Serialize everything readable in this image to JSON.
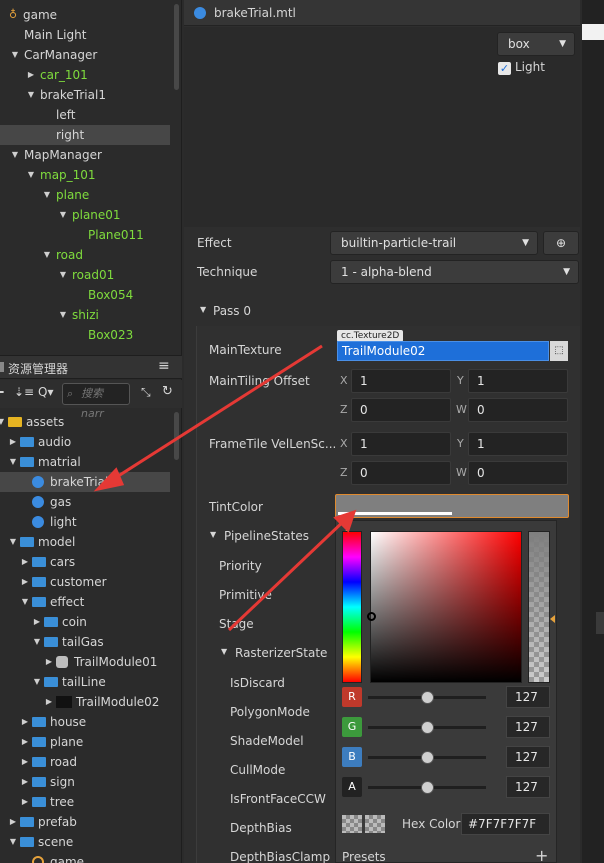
{
  "hierarchy": {
    "items": [
      {
        "label": "game",
        "indent": 0,
        "expanded": true,
        "green": false
      },
      {
        "label": "Main Light",
        "indent": 1,
        "expanded": null,
        "green": false
      },
      {
        "label": "CarManager",
        "indent": 1,
        "expanded": true,
        "green": false
      },
      {
        "label": "car_101",
        "indent": 2,
        "expanded": false,
        "green": true
      },
      {
        "label": "brakeTrial1",
        "indent": 2,
        "expanded": true,
        "green": false
      },
      {
        "label": "left",
        "indent": 3,
        "expanded": null,
        "green": false
      },
      {
        "label": "right",
        "indent": 3,
        "expanded": null,
        "green": false,
        "selected": true
      },
      {
        "label": "MapManager",
        "indent": 1,
        "expanded": true,
        "green": false
      },
      {
        "label": "map_101",
        "indent": 2,
        "expanded": true,
        "green": true
      },
      {
        "label": "plane",
        "indent": 3,
        "expanded": true,
        "green": true
      },
      {
        "label": "plane01",
        "indent": 4,
        "expanded": true,
        "green": true
      },
      {
        "label": "Plane011",
        "indent": 5,
        "expanded": null,
        "green": true
      },
      {
        "label": "road",
        "indent": 3,
        "expanded": true,
        "green": true
      },
      {
        "label": "road01",
        "indent": 4,
        "expanded": true,
        "green": true
      },
      {
        "label": "Box054",
        "indent": 5,
        "expanded": null,
        "green": true
      },
      {
        "label": "shizi",
        "indent": 4,
        "expanded": true,
        "green": true
      },
      {
        "label": "Box023",
        "indent": 5,
        "expanded": null,
        "green": true
      }
    ]
  },
  "assets_panel": {
    "title": "资源管理器",
    "search_placeholder": "搜索 narr",
    "items": [
      {
        "label": "assets",
        "indent": 0,
        "kind": "db",
        "expanded": true
      },
      {
        "label": "audio",
        "indent": 1,
        "kind": "folder",
        "expanded": false
      },
      {
        "label": "matrial",
        "indent": 1,
        "kind": "folder",
        "expanded": true
      },
      {
        "label": "brakeTrial",
        "indent": 2,
        "kind": "mtl",
        "selected": true
      },
      {
        "label": "gas",
        "indent": 2,
        "kind": "mtl"
      },
      {
        "label": "light",
        "indent": 2,
        "kind": "mtl"
      },
      {
        "label": "model",
        "indent": 1,
        "kind": "folder",
        "expanded": true
      },
      {
        "label": "cars",
        "indent": 2,
        "kind": "folder",
        "expanded": false
      },
      {
        "label": "customer",
        "indent": 2,
        "kind": "folder",
        "expanded": false
      },
      {
        "label": "effect",
        "indent": 2,
        "kind": "folder",
        "expanded": true
      },
      {
        "label": "coin",
        "indent": 3,
        "kind": "folder",
        "expanded": false
      },
      {
        "label": "tailGas",
        "indent": 3,
        "kind": "folder",
        "expanded": true
      },
      {
        "label": "TrailModule01",
        "indent": 4,
        "kind": "tex-light",
        "expanded": false
      },
      {
        "label": "tailLine",
        "indent": 3,
        "kind": "folder",
        "expanded": true
      },
      {
        "label": "TrailModule02",
        "indent": 4,
        "kind": "tex-dark",
        "expanded": false
      },
      {
        "label": "house",
        "indent": 2,
        "kind": "folder",
        "expanded": false
      },
      {
        "label": "plane",
        "indent": 2,
        "kind": "folder",
        "expanded": false
      },
      {
        "label": "road",
        "indent": 2,
        "kind": "folder",
        "expanded": false
      },
      {
        "label": "sign",
        "indent": 2,
        "kind": "folder",
        "expanded": false
      },
      {
        "label": "tree",
        "indent": 2,
        "kind": "folder",
        "expanded": false
      },
      {
        "label": "prefab",
        "indent": 1,
        "kind": "folder",
        "expanded": false
      },
      {
        "label": "scene",
        "indent": 1,
        "kind": "folder",
        "expanded": true
      },
      {
        "label": "game",
        "indent": 2,
        "kind": "scene"
      }
    ]
  },
  "inspector": {
    "title": "brakeTrial.mtl",
    "preview_shape": "box",
    "preview_light_label": "Light",
    "preview_light_checked": true,
    "effect_label": "Effect",
    "effect_value": "builtin-particle-trail",
    "technique_label": "Technique",
    "technique_value": "1 - alpha-blend",
    "pass_label": "Pass 0",
    "main_texture_label": "MainTexture",
    "main_texture_type": "cc.Texture2D",
    "main_texture_value": "TrailModule02",
    "tiling_label": "MainTiling Offset",
    "tiling": {
      "x": "1",
      "y": "1",
      "z": "0",
      "w": "0"
    },
    "frametile_label": "FrameTile VelLenSc...",
    "frametile": {
      "x": "1",
      "y": "1",
      "z": "0",
      "w": "0"
    },
    "tint_label": "TintColor",
    "pipeline_label": "PipelineStates",
    "pipeline_items": [
      "Priority",
      "Primitive",
      "Stage"
    ],
    "raster_label": "RasterizerState",
    "raster_items": [
      "IsDiscard",
      "PolygonMode",
      "ShadeModel",
      "CullMode",
      "IsFrontFaceCCW",
      "DepthBias",
      "DepthBiasClamp"
    ]
  },
  "color_picker": {
    "channels": [
      {
        "name": "R",
        "value": "127",
        "color": "#c0392b"
      },
      {
        "name": "G",
        "value": "127",
        "color": "#3c9a3c"
      },
      {
        "name": "B",
        "value": "127",
        "color": "#3d7dbf"
      },
      {
        "name": "A",
        "value": "127",
        "color": "#222222"
      }
    ],
    "hex_label": "Hex Color",
    "hex_value": "#7F7F7F7F",
    "presets_label": "Presets",
    "add_icon": "+"
  },
  "colors": {
    "accent_blue": "#1e6fd9",
    "tint": "#7f7f7f",
    "green_text": "#7fdc3d",
    "highlight_border": "#e08a2e",
    "arrow_red": "#e53935"
  }
}
